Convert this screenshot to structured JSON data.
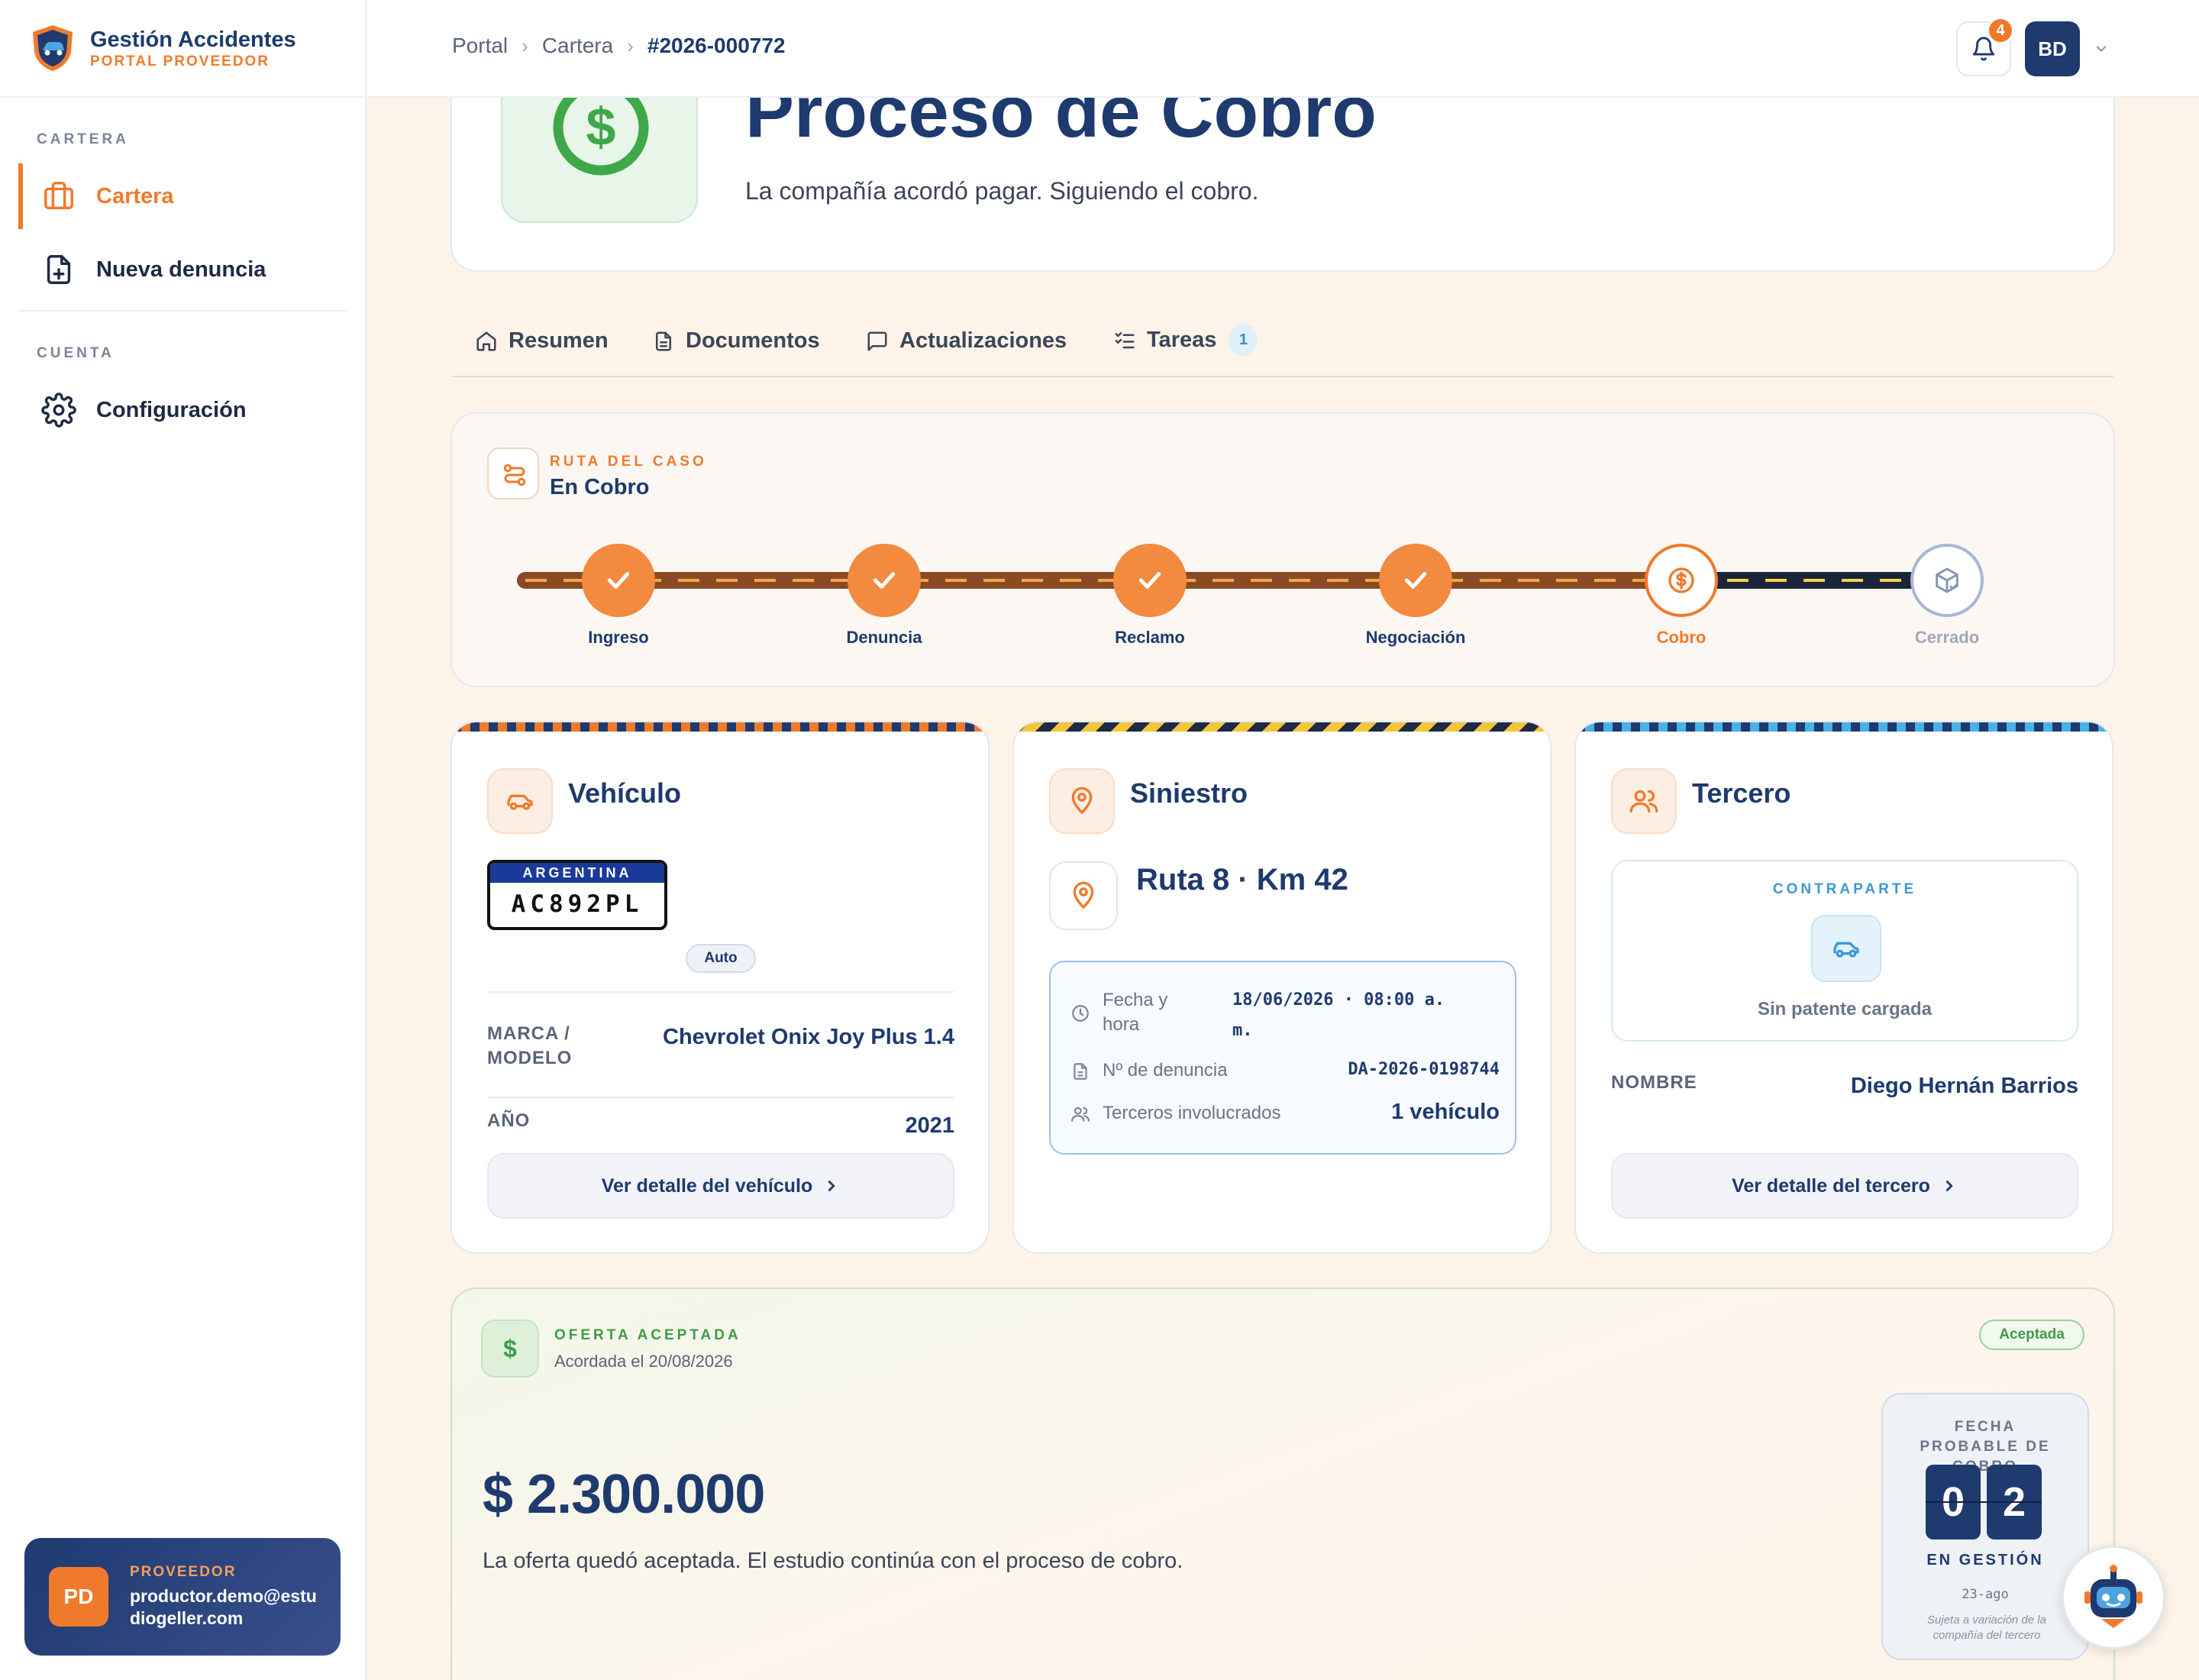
{
  "brand": {
    "title": "Gestión Accidentes",
    "subtitle": "PORTAL PROVEEDOR"
  },
  "sidebar": {
    "section_cartera": "CARTERA",
    "section_cuenta": "CUENTA",
    "items": [
      {
        "label": "Cartera",
        "icon": "briefcase-icon",
        "active": true
      },
      {
        "label": "Nueva denuncia",
        "icon": "file-plus-icon",
        "active": false
      },
      {
        "label": "Configuración",
        "icon": "gear-icon",
        "active": false
      }
    ]
  },
  "user": {
    "initials": "PD",
    "role": "PROVEEDOR",
    "email": "productor.demo@estudiogeller.com"
  },
  "topbar": {
    "breadcrumbs": [
      "Portal",
      "Cartera",
      "#2026-000772"
    ],
    "notifications": "4",
    "avatar_initials": "BD"
  },
  "hero": {
    "title": "Proceso de Cobro",
    "subtitle": "La compañía acordó pagar. Siguiendo el cobro."
  },
  "tabs": [
    {
      "label": "Resumen",
      "icon": "home-icon"
    },
    {
      "label": "Documentos",
      "icon": "document-icon"
    },
    {
      "label": "Actualizaciones",
      "icon": "chat-icon"
    },
    {
      "label": "Tareas",
      "icon": "checklist-icon",
      "badge": "1"
    }
  ],
  "route": {
    "label": "RUTA DEL CASO",
    "status": "En Cobro",
    "steps": [
      {
        "label": "Ingreso",
        "state": "done"
      },
      {
        "label": "Denuncia",
        "state": "done"
      },
      {
        "label": "Reclamo",
        "state": "done"
      },
      {
        "label": "Negociación",
        "state": "done"
      },
      {
        "label": "Cobro",
        "state": "current"
      },
      {
        "label": "Cerrado",
        "state": "pending"
      }
    ]
  },
  "vehicle": {
    "title": "Vehículo",
    "plate_country": "ARGENTINA",
    "plate": "AC892PL",
    "type": "Auto",
    "brand_label": "MARCA / MODELO",
    "brand_value": "Chevrolet Onix Joy Plus 1.4",
    "year_label": "AÑO",
    "year_value": "2021",
    "button": "Ver detalle del vehículo"
  },
  "incident": {
    "title": "Siniestro",
    "location": "Ruta 8 · Km 42",
    "date_label": "Fecha y hora",
    "date_value": "18/06/2026 · 08:00 a. m.",
    "report_label": "Nº de denuncia",
    "report_value": "DA-2026-0198744",
    "third_label": "Terceros involucrados",
    "third_value": "1 vehículo"
  },
  "third": {
    "title": "Tercero",
    "counterpart_label": "CONTRAPARTE",
    "counterpart_value": "Sin patente cargada",
    "name_label": "NOMBRE",
    "name_value": "Diego Hernán Barrios",
    "button": "Ver detalle del tercero"
  },
  "offer": {
    "label": "OFERTA ACEPTADA",
    "date": "Acordada el 20/08/2026",
    "badge": "Aceptada",
    "amount": "$ 2.300.000",
    "text": "La oferta quedó aceptada. El estudio continúa con el proceso de cobro.",
    "payday_label": "FECHA PROBABLE DE COBRO",
    "digits": [
      "0",
      "2"
    ],
    "payday_status": "EN GESTIÓN",
    "payday_date": "23-ago",
    "payday_note": "Sujeta a variación de la compañía del tercero"
  },
  "colors": {
    "accent": "#f07a2c",
    "primary": "#1e3a6e",
    "success": "#3f9a4c",
    "info": "#3a8fc6"
  }
}
